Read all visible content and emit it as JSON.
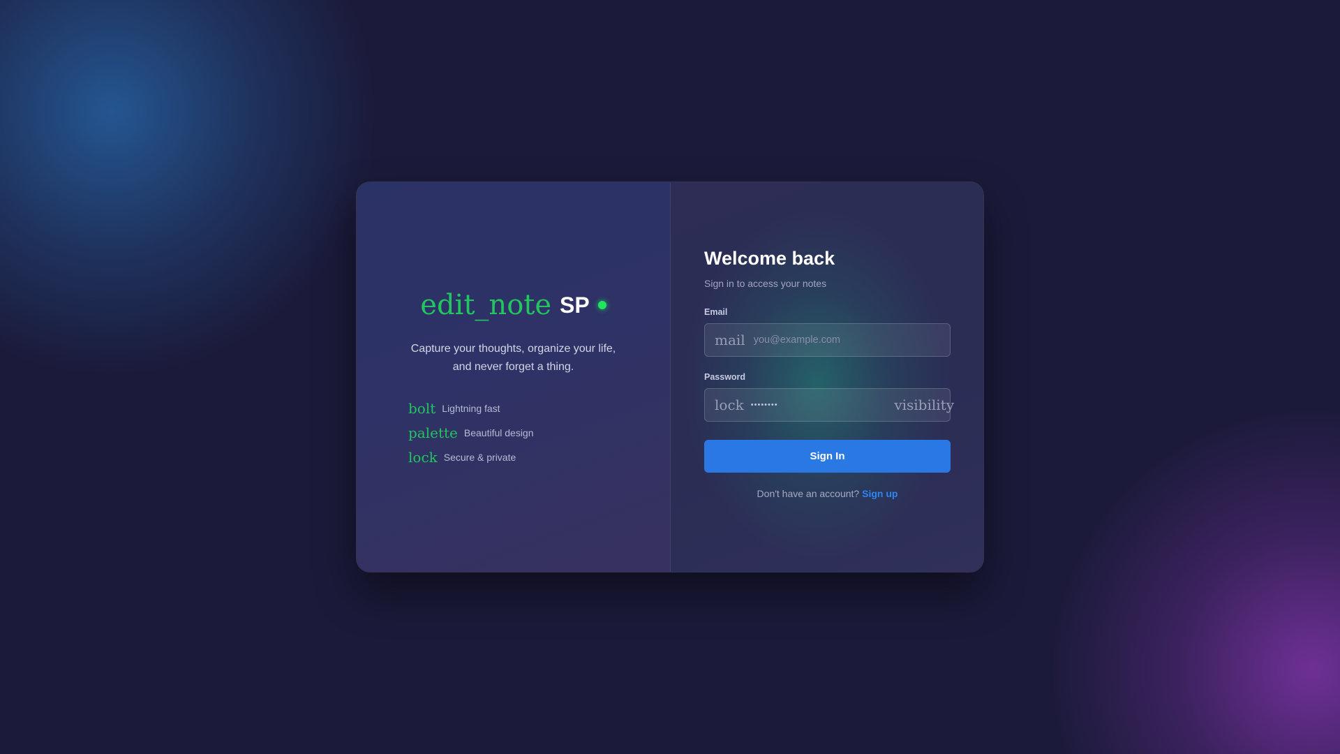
{
  "brand": {
    "icon": "edit_note",
    "name": "SP",
    "status_color": "#22e55e"
  },
  "tagline": [
    "Capture your thoughts, organize your life,",
    "and never forget a thing."
  ],
  "features": [
    {
      "icon": "bolt",
      "label": "Lightning fast"
    },
    {
      "icon": "palette",
      "label": "Beautiful design"
    },
    {
      "icon": "lock",
      "label": "Secure & private"
    }
  ],
  "form": {
    "title": "Welcome back",
    "subtitle": "Sign in to access your notes",
    "email": {
      "label": "Email",
      "icon": "mail",
      "placeholder": "you@example.com",
      "value": ""
    },
    "password": {
      "label": "Password",
      "icon": "lock",
      "value_masked": "••••••••",
      "toggle_icon": "visibility"
    },
    "submit_label": "Sign In",
    "signup_prompt": "Don't have an account?",
    "signup_link": "Sign up"
  },
  "colors": {
    "accent_green": "#22c55e",
    "primary_blue": "#2a78e4",
    "link_blue": "#2f86f0",
    "background": "#1b1a3a"
  }
}
